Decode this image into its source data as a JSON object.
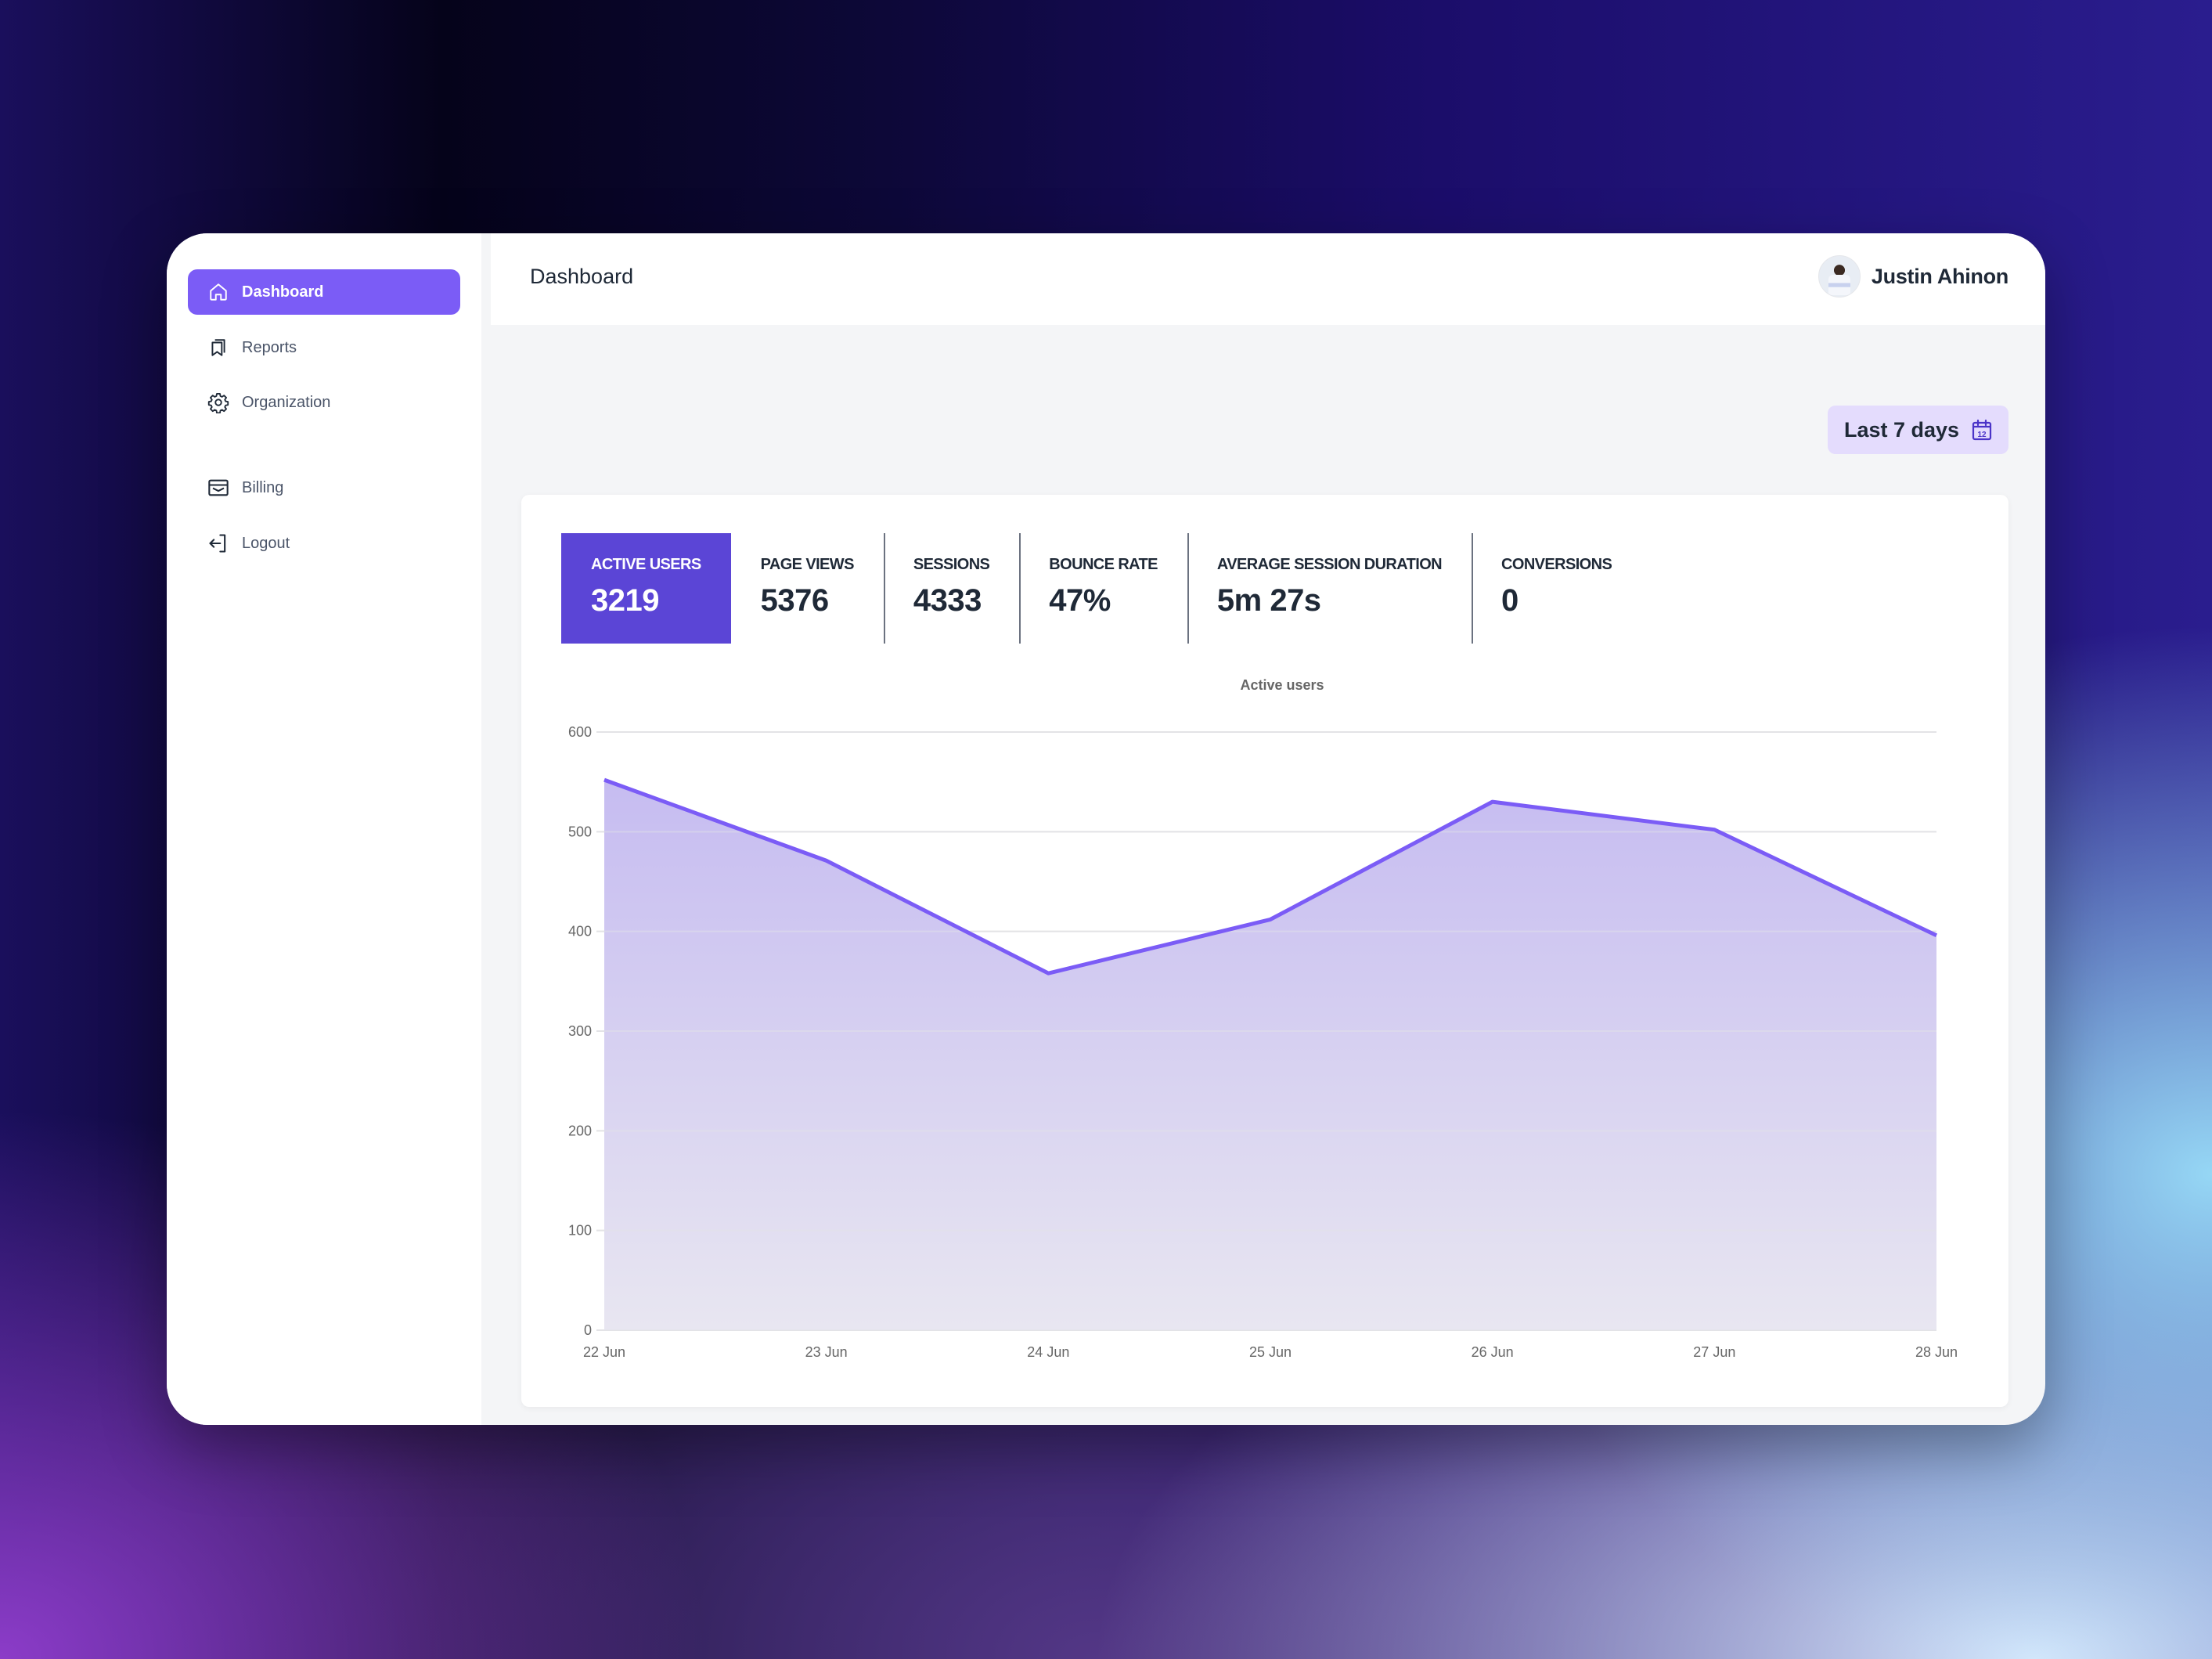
{
  "sidebar": {
    "items": [
      {
        "label": "Dashboard",
        "icon": "home-icon",
        "active": true
      },
      {
        "label": "Reports",
        "icon": "bookmarks-icon",
        "active": false
      },
      {
        "label": "Organization",
        "icon": "gear-icon",
        "active": false
      },
      {
        "label": "Billing",
        "icon": "wallet-icon",
        "active": false
      },
      {
        "label": "Logout",
        "icon": "logout-icon",
        "active": false
      }
    ]
  },
  "header": {
    "title": "Dashboard",
    "user_name": "Justin Ahinon"
  },
  "filter": {
    "date_range_label": "Last 7 days",
    "calendar_icon_day": "12"
  },
  "stats": [
    {
      "label": "ACTIVE USERS",
      "value": "3219",
      "active": true
    },
    {
      "label": "PAGE VIEWS",
      "value": "5376",
      "active": false
    },
    {
      "label": "SESSIONS",
      "value": "4333",
      "active": false
    },
    {
      "label": "BOUNCE RATE",
      "value": "47%",
      "active": false
    },
    {
      "label": "AVERAGE SESSION DURATION",
      "value": "5m 27s",
      "active": false
    },
    {
      "label": "CONVERSIONS",
      "value": "0",
      "active": false
    }
  ],
  "colors": {
    "accent": "#7b5cf6",
    "active_tab": "#5b45d6",
    "line": "#7b5cf6",
    "area": "#c9bff0",
    "date_button_bg": "#e4dcfd"
  },
  "chart_data": {
    "type": "area",
    "title": "Active users",
    "xlabel": "",
    "ylabel": "",
    "x": [
      "22 Jun",
      "23 Jun",
      "24 Jun",
      "25 Jun",
      "26 Jun",
      "27 Jun",
      "28 Jun"
    ],
    "series": [
      {
        "name": "Active users",
        "values": [
          552,
          471,
          358,
          412,
          530,
          502,
          396
        ]
      }
    ],
    "ylim": [
      0,
      600
    ],
    "yticks": [
      0,
      100,
      200,
      300,
      400,
      500,
      600
    ],
    "grid": true,
    "legend": "none"
  }
}
